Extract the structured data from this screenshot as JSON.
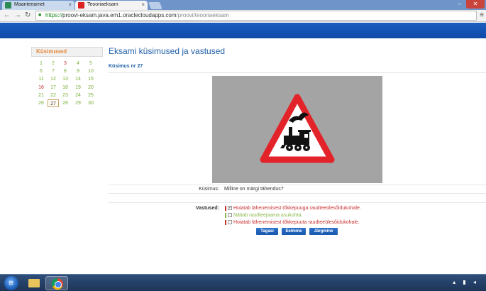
{
  "browser": {
    "tabs": [
      {
        "label": "Maanteeamet",
        "active": false
      },
      {
        "label": "Teooriaeksam",
        "active": true
      }
    ],
    "url_scheme": "https://",
    "url_host": "proovi-eksam.java.em1.oraclecloudapps.com",
    "url_path": "/proovi/teooriaeksam"
  },
  "sidebar": {
    "title": "Küsimused",
    "questions": [
      {
        "n": "1",
        "state": "correct"
      },
      {
        "n": "2",
        "state": "correct"
      },
      {
        "n": "3",
        "state": "wrong"
      },
      {
        "n": "4",
        "state": "correct"
      },
      {
        "n": "5",
        "state": "correct"
      },
      {
        "n": "6",
        "state": "correct"
      },
      {
        "n": "7",
        "state": "correct"
      },
      {
        "n": "8",
        "state": "correct"
      },
      {
        "n": "9",
        "state": "correct"
      },
      {
        "n": "10",
        "state": "correct"
      },
      {
        "n": "11",
        "state": "correct"
      },
      {
        "n": "12",
        "state": "correct"
      },
      {
        "n": "13",
        "state": "correct"
      },
      {
        "n": "14",
        "state": "correct"
      },
      {
        "n": "15",
        "state": "correct"
      },
      {
        "n": "16",
        "state": "wrong"
      },
      {
        "n": "17",
        "state": "correct"
      },
      {
        "n": "18",
        "state": "correct"
      },
      {
        "n": "19",
        "state": "correct"
      },
      {
        "n": "20",
        "state": "correct"
      },
      {
        "n": "21",
        "state": "correct"
      },
      {
        "n": "22",
        "state": "correct"
      },
      {
        "n": "23",
        "state": "correct"
      },
      {
        "n": "24",
        "state": "correct"
      },
      {
        "n": "25",
        "state": "correct"
      },
      {
        "n": "26",
        "state": "correct"
      },
      {
        "n": "27",
        "state": "current"
      },
      {
        "n": "28",
        "state": "correct"
      },
      {
        "n": "29",
        "state": "correct"
      },
      {
        "n": "30",
        "state": "correct"
      }
    ]
  },
  "main": {
    "title": "Eksami küsimused ja vastused",
    "question_label": "Küsimus nr 27",
    "kysimus_label": "Küsimus:",
    "kysimus_text": "Milline on märgi tähendus?",
    "vastused_label": "Vastused:",
    "answers": [
      {
        "text": "Hoiatab lähenemisest tõkkepuuga raudteeülesõidukohale.",
        "checked": true,
        "state": "wrong"
      },
      {
        "text": "Näitab raudteejaama asukohta.",
        "checked": false,
        "state": "correct"
      },
      {
        "text": "Hoiatab lähenemisest tõkkepuuta raudteeülesõidukohale.",
        "checked": false,
        "state": "wrong"
      }
    ],
    "buttons": {
      "prev": "Tagasi",
      "back": "Eelmine",
      "next": "Järgmine"
    }
  },
  "colors": {
    "header_blue": "#1b5dbe",
    "title_blue": "#1f5fa8",
    "correct_green": "#7ab03a",
    "wrong_red": "#c93030",
    "sidebar_title_orange": "#e5893c"
  }
}
